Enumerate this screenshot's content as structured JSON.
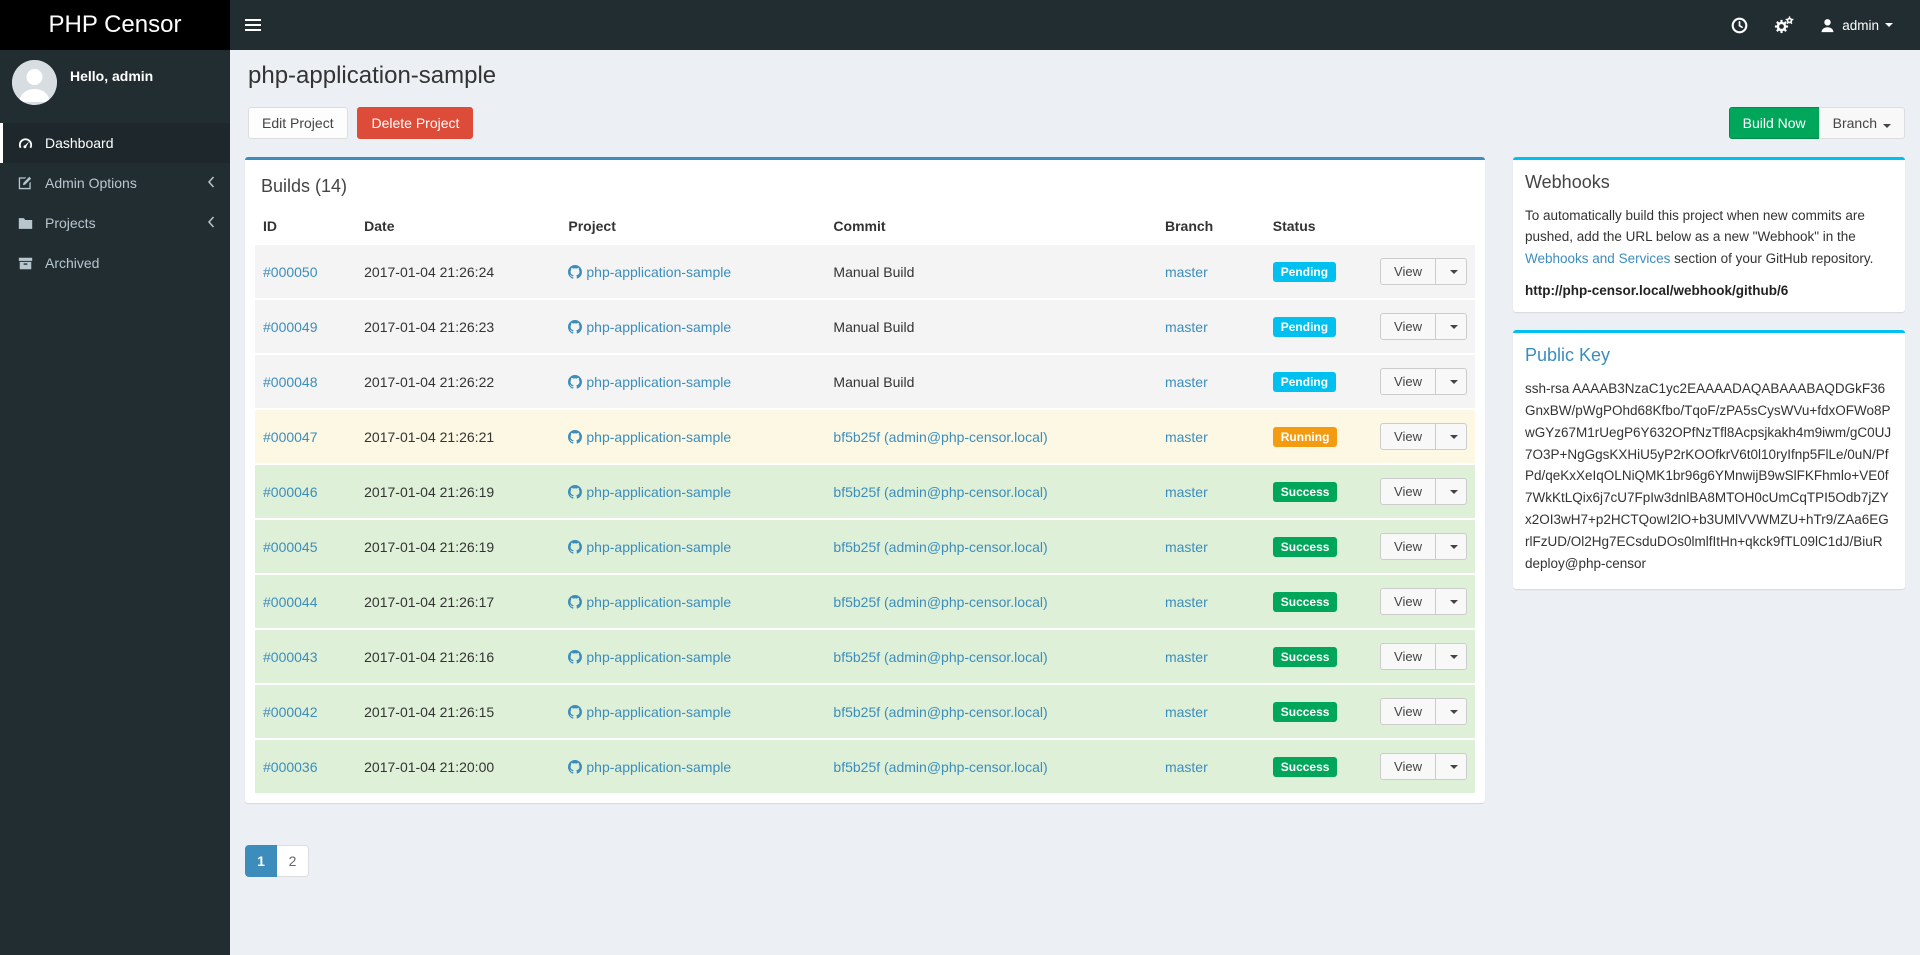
{
  "brand": {
    "title": "PHP Censor"
  },
  "topbar": {
    "user_label": "admin",
    "icons": [
      "clock-icon",
      "gears-icon",
      "user-icon"
    ]
  },
  "sidebar": {
    "greeting": "Hello, admin",
    "items": [
      {
        "label": "Dashboard",
        "icon": "dashboard-icon",
        "active": true
      },
      {
        "label": "Admin Options",
        "icon": "edit-icon",
        "chevron": true
      },
      {
        "label": "Projects",
        "icon": "folder-icon",
        "chevron": true
      },
      {
        "label": "Archived",
        "icon": "archive-icon"
      }
    ]
  },
  "page": {
    "title": "php-application-sample",
    "edit_button": "Edit Project",
    "delete_button": "Delete Project",
    "build_now_button": "Build Now",
    "branch_button": "Branch"
  },
  "builds": {
    "panel_title": "Builds (14)",
    "columns": [
      "ID",
      "Date",
      "Project",
      "Commit",
      "Branch",
      "Status"
    ],
    "view_label": "View",
    "rows": [
      {
        "id": "#000050",
        "date": "2017-01-04 21:26:24",
        "project": "php-application-sample",
        "commit": "Manual Build",
        "commit_is_link": false,
        "branch": "master",
        "status": "Pending",
        "row_style": "pending"
      },
      {
        "id": "#000049",
        "date": "2017-01-04 21:26:23",
        "project": "php-application-sample",
        "commit": "Manual Build",
        "commit_is_link": false,
        "branch": "master",
        "status": "Pending",
        "row_style": "pending"
      },
      {
        "id": "#000048",
        "date": "2017-01-04 21:26:22",
        "project": "php-application-sample",
        "commit": "Manual Build",
        "commit_is_link": false,
        "branch": "master",
        "status": "Pending",
        "row_style": "pending"
      },
      {
        "id": "#000047",
        "date": "2017-01-04 21:26:21",
        "project": "php-application-sample",
        "commit": "bf5b25f (admin@php-censor.local)",
        "commit_is_link": true,
        "branch": "master",
        "status": "Running",
        "row_style": "running"
      },
      {
        "id": "#000046",
        "date": "2017-01-04 21:26:19",
        "project": "php-application-sample",
        "commit": "bf5b25f (admin@php-censor.local)",
        "commit_is_link": true,
        "branch": "master",
        "status": "Success",
        "row_style": "success"
      },
      {
        "id": "#000045",
        "date": "2017-01-04 21:26:19",
        "project": "php-application-sample",
        "commit": "bf5b25f (admin@php-censor.local)",
        "commit_is_link": true,
        "branch": "master",
        "status": "Success",
        "row_style": "success"
      },
      {
        "id": "#000044",
        "date": "2017-01-04 21:26:17",
        "project": "php-application-sample",
        "commit": "bf5b25f (admin@php-censor.local)",
        "commit_is_link": true,
        "branch": "master",
        "status": "Success",
        "row_style": "success"
      },
      {
        "id": "#000043",
        "date": "2017-01-04 21:26:16",
        "project": "php-application-sample",
        "commit": "bf5b25f (admin@php-censor.local)",
        "commit_is_link": true,
        "branch": "master",
        "status": "Success",
        "row_style": "success"
      },
      {
        "id": "#000042",
        "date": "2017-01-04 21:26:15",
        "project": "php-application-sample",
        "commit": "bf5b25f (admin@php-censor.local)",
        "commit_is_link": true,
        "branch": "master",
        "status": "Success",
        "row_style": "success"
      },
      {
        "id": "#000036",
        "date": "2017-01-04 21:20:00",
        "project": "php-application-sample",
        "commit": "bf5b25f (admin@php-censor.local)",
        "commit_is_link": true,
        "branch": "master",
        "status": "Success",
        "row_style": "success"
      }
    ]
  },
  "pagination": {
    "pages": [
      "1",
      "2"
    ],
    "active": "1"
  },
  "webhooks": {
    "title": "Webhooks",
    "text_before_link": "To automatically build this project when new commits are pushed, add the URL below as a new \"Webhook\" in the ",
    "link_text": "Webhooks and Services",
    "text_after_link": " section of your GitHub repository.",
    "url": "http://php-censor.local/webhook/github/6"
  },
  "public_key": {
    "title": "Public Key",
    "key": "ssh-rsa AAAAB3NzaC1yc2EAAAADAQABAAABAQDGkF36GnxBW/pWgPOhd68Kfbo/TqoF/zPA5sCysWVu+fdxOFWo8PwGYz67M1rUegP6Y632OPfNzTfl8Acpsjkakh4m9iwm/gC0UJ7O3P+NgGgsKXHiU5yP2rKOOfkrV6t0l10ryIfnp5FlLe/0uN/PfPd/qeKxXeIqOLNiQMK1br96g6YMnwijB9wSlFKFhmlo+VE0f7WkKtLQix6j7cU7FpIw3dnlBA8MTOH0cUmCqTPI5Odb7jZYx2OI3wH7+p2HCTQowI2lO+b3UMlVVWMZU+hTr9/ZAa6EGrlFzUD/Ol2Hg7ECsduDOs0lmlfItHn+qkck9fTL09lC1dJ/BiuR deploy@php-censor"
  },
  "colors": {
    "accent_blue": "#3c8dbc",
    "info_cyan": "#00c0ef",
    "success_green": "#00a65a",
    "warning_orange": "#f39c12",
    "danger_red": "#dd4b39",
    "sidebar_dark": "#222d32",
    "status": {
      "Pending": "#00c0ef",
      "Running": "#f39c12",
      "Success": "#00a65a"
    },
    "row_bg": {
      "pending": "#f4f4f4",
      "running": "#fcf8e3",
      "success": "#dff0d8"
    }
  }
}
